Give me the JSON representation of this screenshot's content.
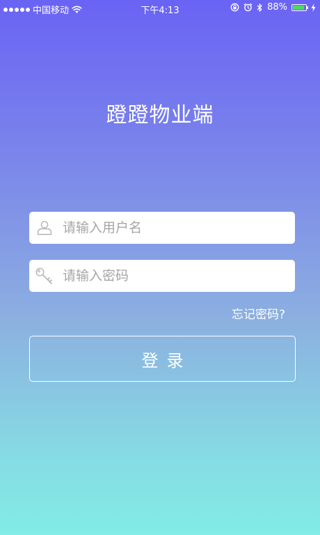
{
  "status_bar": {
    "carrier": "中国移动",
    "time": "下午4:13",
    "battery_percent": "88%",
    "battery_level": 0.88,
    "battery_color": "#4cd964"
  },
  "app": {
    "title": "蹬蹬物业端"
  },
  "login_form": {
    "username_placeholder": "请输入用户名",
    "username_value": "",
    "password_placeholder": "请输入密码",
    "password_value": "",
    "forgot_password": "忘记密码?",
    "login_button": "登录"
  },
  "icons": {
    "username": "user-icon",
    "password": "key-icon"
  },
  "colors": {
    "gradient_top": "#6a63f4",
    "gradient_bottom": "#82ece6",
    "field_background": "#ffffff",
    "placeholder_text": "#a6a6a6"
  }
}
